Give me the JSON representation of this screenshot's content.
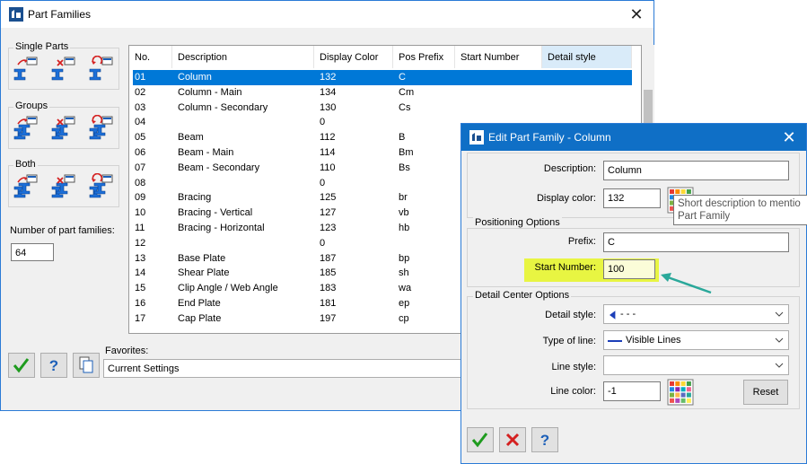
{
  "main": {
    "title": "Part Families",
    "groups": {
      "single": "Single Parts",
      "groups": "Groups",
      "both": "Both"
    },
    "num_label": "Number of part families:",
    "num_value": "64",
    "favorites_label": "Favorites:",
    "favorites_value": "Current Settings",
    "columns": [
      "No.",
      "Description",
      "Display Color",
      "Pos Prefix",
      "Start Number",
      "Detail style"
    ],
    "rows": [
      {
        "no": "01",
        "desc": "Column",
        "color": "132",
        "prefix": "C"
      },
      {
        "no": "02",
        "desc": "Column - Main",
        "color": "134",
        "prefix": "Cm"
      },
      {
        "no": "03",
        "desc": "Column - Secondary",
        "color": "130",
        "prefix": "Cs"
      },
      {
        "no": "04",
        "desc": "",
        "color": "0",
        "prefix": ""
      },
      {
        "no": "05",
        "desc": "Beam",
        "color": "112",
        "prefix": "B"
      },
      {
        "no": "06",
        "desc": "Beam - Main",
        "color": "114",
        "prefix": "Bm"
      },
      {
        "no": "07",
        "desc": "Beam - Secondary",
        "color": "110",
        "prefix": "Bs"
      },
      {
        "no": "08",
        "desc": "",
        "color": "0",
        "prefix": ""
      },
      {
        "no": "09",
        "desc": "Bracing",
        "color": "125",
        "prefix": "br"
      },
      {
        "no": "10",
        "desc": "Bracing - Vertical",
        "color": "127",
        "prefix": "vb"
      },
      {
        "no": "11",
        "desc": "Bracing - Horizontal",
        "color": "123",
        "prefix": "hb"
      },
      {
        "no": "12",
        "desc": "",
        "color": "0",
        "prefix": ""
      },
      {
        "no": "13",
        "desc": "Base Plate",
        "color": "187",
        "prefix": "bp"
      },
      {
        "no": "14",
        "desc": "Shear Plate",
        "color": "185",
        "prefix": "sh"
      },
      {
        "no": "15",
        "desc": "Clip Angle / Web Angle",
        "color": "183",
        "prefix": "wa"
      },
      {
        "no": "16",
        "desc": "End Plate",
        "color": "181",
        "prefix": "ep"
      },
      {
        "no": "17",
        "desc": "Cap Plate",
        "color": "197",
        "prefix": "cp"
      }
    ]
  },
  "edit": {
    "title": "Edit Part Family - Column",
    "description_label": "Description:",
    "description_value": "Column",
    "display_color_label": "Display color:",
    "display_color_value": "132",
    "tooltip_line1": "Short description to mentio",
    "tooltip_line2": "Part Family",
    "positioning_label": "Positioning Options",
    "prefix_label": "Prefix:",
    "prefix_value": "C",
    "start_number_label": "Start Number:",
    "start_number_value": "100",
    "detail_center_label": "Detail Center Options",
    "detail_style_label": "Detail style:",
    "detail_style_value": "- - -",
    "type_of_line_label": "Type of line:",
    "type_of_line_value": "Visible Lines",
    "line_style_label": "Line style:",
    "line_style_value": "",
    "line_color_label": "Line color:",
    "line_color_value": "-1",
    "reset_label": "Reset"
  },
  "colors": {
    "accent": "#0078d7",
    "highlight": "#e8f542",
    "arrow": "#2aa89a"
  }
}
